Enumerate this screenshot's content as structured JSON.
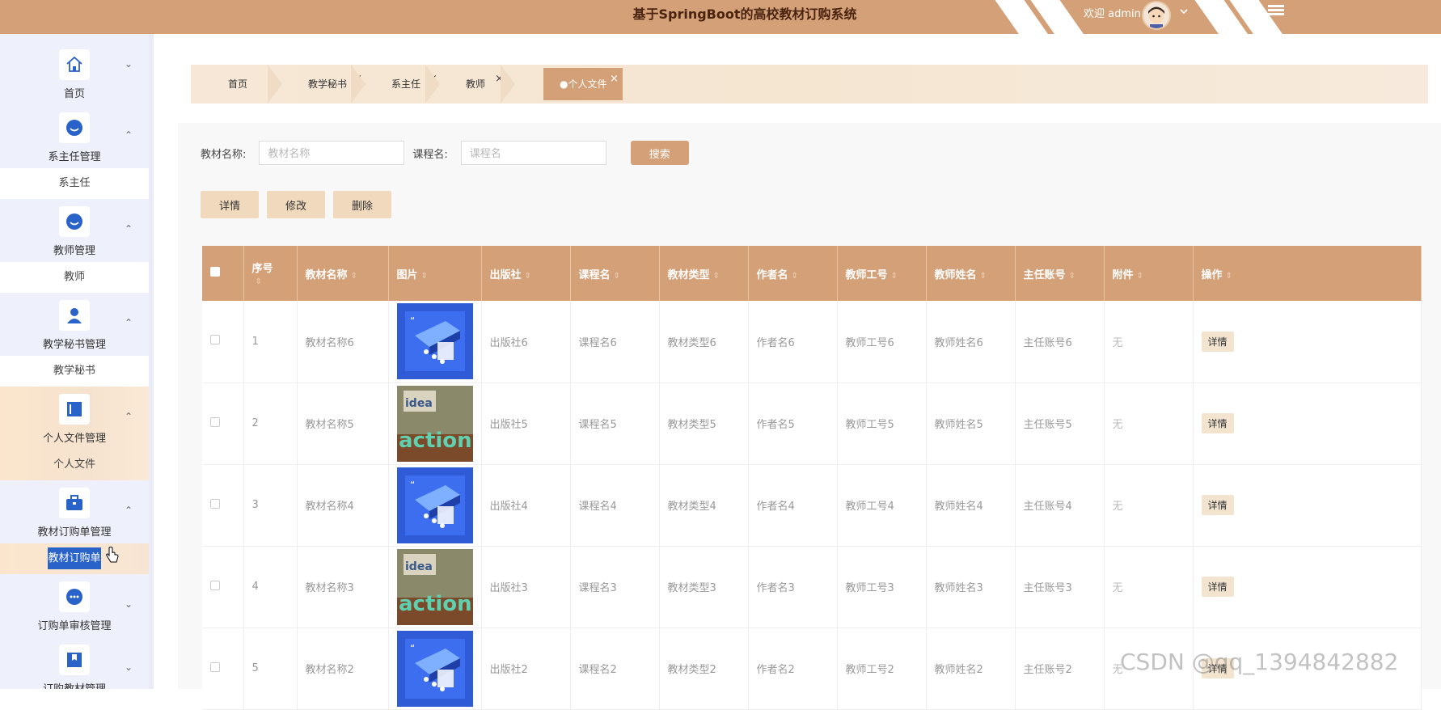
{
  "header": {
    "title": "基于SpringBoot的高校教材订购系统",
    "welcome": "欢迎 admin"
  },
  "sidebar": {
    "groups": [
      {
        "label": "首页",
        "icon": "home-icon",
        "sub": null
      },
      {
        "label": "系主任管理",
        "icon": "user-icon",
        "sub": "系主任"
      },
      {
        "label": "教师管理",
        "icon": "user-icon",
        "sub": "教师"
      },
      {
        "label": "教学秘书管理",
        "icon": "person-icon",
        "sub": "教学秘书"
      },
      {
        "label": "个人文件管理",
        "icon": "book-icon",
        "sub": "个人文件"
      },
      {
        "label": "教材订购单管理",
        "icon": "briefcase-icon",
        "sub": "教材订购单"
      },
      {
        "label": "订购单审核管理",
        "icon": "chat-icon",
        "sub": null
      },
      {
        "label": "订购教材管理",
        "icon": "bookmark-icon",
        "sub": null
      }
    ]
  },
  "breadcrumb": {
    "items": [
      "首页",
      "教学秘书",
      "系主任",
      "教师",
      "●个人文件"
    ],
    "close": "×"
  },
  "search": {
    "label1": "教材名称:",
    "placeholder1": "教材名称",
    "label2": "课程名:",
    "placeholder2": "课程名",
    "button": "搜索"
  },
  "actions": {
    "detail": "详情",
    "edit": "修改",
    "delete": "删除"
  },
  "table": {
    "headers": [
      "序号",
      "教材名称",
      "图片",
      "出版社",
      "课程名",
      "教材类型",
      "作者名",
      "教师工号",
      "教师姓名",
      "主任账号",
      "附件",
      "操作"
    ],
    "rows": [
      {
        "no": "1",
        "name": "教材名称6",
        "img": "isometric",
        "pub": "出版社6",
        "course": "课程名6",
        "type": "教材类型6",
        "author": "作者名6",
        "tid": "教师工号6",
        "tname": "教师姓名6",
        "dir": "主任账号6",
        "att": "无",
        "op": "详情"
      },
      {
        "no": "2",
        "name": "教材名称5",
        "img": "action",
        "pub": "出版社5",
        "course": "课程名5",
        "type": "教材类型5",
        "author": "作者名5",
        "tid": "教师工号5",
        "tname": "教师姓名5",
        "dir": "主任账号5",
        "att": "无",
        "op": "详情"
      },
      {
        "no": "3",
        "name": "教材名称4",
        "img": "isometric",
        "pub": "出版社4",
        "course": "课程名4",
        "type": "教材类型4",
        "author": "作者名4",
        "tid": "教师工号4",
        "tname": "教师姓名4",
        "dir": "主任账号4",
        "att": "无",
        "op": "详情"
      },
      {
        "no": "4",
        "name": "教材名称3",
        "img": "action",
        "pub": "出版社3",
        "course": "课程名3",
        "type": "教材类型3",
        "author": "作者名3",
        "tid": "教师工号3",
        "tname": "教师姓名3",
        "dir": "主任账号3",
        "att": "无",
        "op": "详情"
      },
      {
        "no": "5",
        "name": "教材名称2",
        "img": "isometric",
        "pub": "出版社2",
        "course": "课程名2",
        "type": "教材类型2",
        "author": "作者名2",
        "tid": "教师工号2",
        "tname": "教师姓名2",
        "dir": "主任账号2",
        "att": "无",
        "op": "详情"
      }
    ]
  },
  "watermark": "CSDN @qq_1394842882",
  "colors": {
    "accent": "#d4a078",
    "header_text": "#4a2410",
    "sidebar_bg": "#eef0fb",
    "highlight": "#2962c9"
  }
}
